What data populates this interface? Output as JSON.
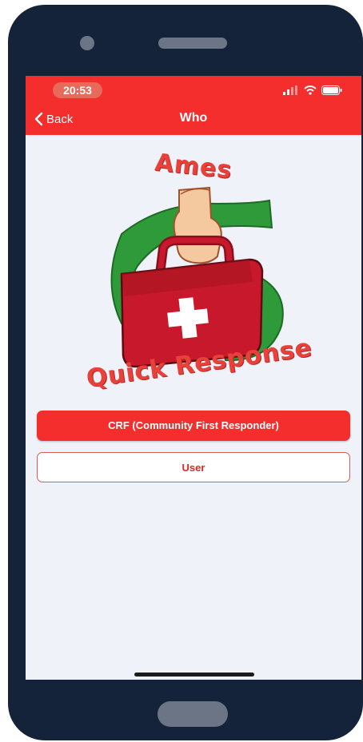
{
  "status_bar": {
    "time": "20:53"
  },
  "nav": {
    "back_label": "Back",
    "title": "Who"
  },
  "logo": {
    "top_text": "Ames",
    "bottom_text": "Quick Response"
  },
  "buttons": {
    "crf_label": "CRF (Community First Responder)",
    "user_label": "User"
  },
  "colors": {
    "header_red": "#f42d2d",
    "logo_green": "#2f9a3a",
    "bag_red": "#c8192c",
    "background": "#eff2f8"
  },
  "icons": [
    "chevron-left-icon",
    "signal-icon",
    "wifi-icon",
    "battery-icon",
    "first-aid-logo"
  ]
}
